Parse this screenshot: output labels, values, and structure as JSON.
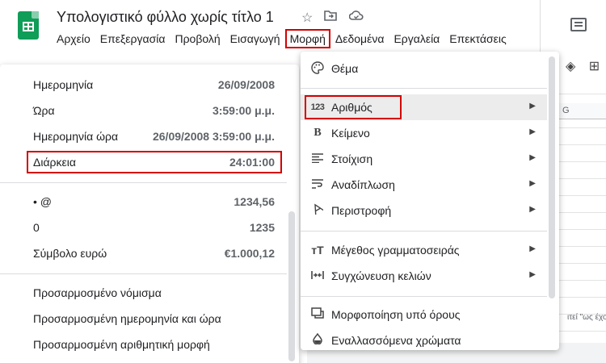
{
  "header": {
    "doc_title": "Υπολογιστικό φύλλο χωρίς τίτλο 1",
    "star_icon": "star-icon",
    "move_icon": "folder-move-icon",
    "cloud_icon": "cloud-status-icon"
  },
  "menubar": {
    "items": [
      {
        "label": "Αρχείο"
      },
      {
        "label": "Επεξεργασία"
      },
      {
        "label": "Προβολή"
      },
      {
        "label": "Εισαγωγή"
      },
      {
        "label": "Μορφή"
      },
      {
        "label": "Δεδομένα"
      },
      {
        "label": "Εργαλεία"
      },
      {
        "label": "Επεκτάσεις"
      }
    ]
  },
  "number_submenu": {
    "items": [
      {
        "label": "Ημερομηνία",
        "example": "26/09/2008"
      },
      {
        "label": "Ώρα",
        "example": "3:59:00 μ.μ."
      },
      {
        "label": "Ημερομηνία ώρα",
        "example": "26/09/2008 3:59:00 μ.μ."
      },
      {
        "label": "Διάρκεια",
        "example": "24:01:00"
      },
      {
        "label": "• @",
        "example": "1234,56"
      },
      {
        "label": "0",
        "example": "1235"
      },
      {
        "label": "Σύμβολο ευρώ",
        "example": "€1.000,12"
      },
      {
        "label": "Προσαρμοσμένο νόμισμα"
      },
      {
        "label": "Προσαρμοσμένη ημερομηνία και ώρα"
      },
      {
        "label": "Προσαρμοσμένη αριθμητική μορφή"
      }
    ]
  },
  "format_menu": {
    "items": [
      {
        "label": "Θέμα",
        "icon": "palette-icon"
      },
      {
        "label": "Αριθμός",
        "icon": "number-123-icon"
      },
      {
        "label": "Κείμενο",
        "icon": "bold-icon"
      },
      {
        "label": "Στοίχιση",
        "icon": "align-left-icon"
      },
      {
        "label": "Αναδίπλωση",
        "icon": "text-wrap-icon"
      },
      {
        "label": "Περιστροφή",
        "icon": "text-rotation-icon"
      },
      {
        "label": "Μέγεθος γραμματοσειράς",
        "icon": "font-size-icon"
      },
      {
        "label": "Συγχώνευση κελιών",
        "icon": "merge-cells-icon"
      },
      {
        "label": "Μορφοποίηση υπό όρους",
        "icon": "conditional-format-icon"
      },
      {
        "label": "Εναλλασσόμενα χρώματα",
        "icon": "alternating-colors-icon"
      }
    ]
  },
  "sheet": {
    "column_header": "G",
    "cell_snippet": "ιτεί \"ως έχου"
  },
  "colors": {
    "highlight_border": "#d40000",
    "sheets_green": "#0f9d58",
    "menu_hover": "#ececec"
  }
}
